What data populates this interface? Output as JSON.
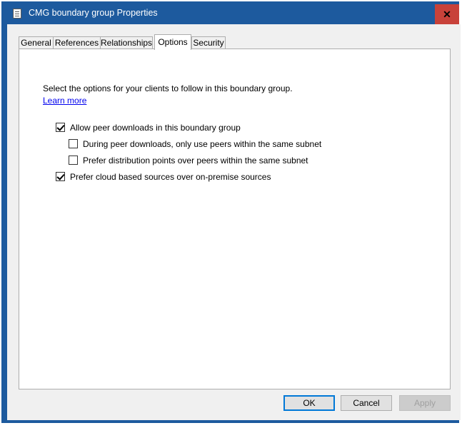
{
  "window": {
    "title": "CMG boundary group Properties",
    "close_glyph": "✕"
  },
  "tabs": [
    {
      "label": "General"
    },
    {
      "label": "References"
    },
    {
      "label": "Relationships"
    },
    {
      "label": "Options",
      "active": true
    },
    {
      "label": "Security"
    }
  ],
  "options_panel": {
    "description": "Select the options for your clients to follow in this boundary group.",
    "learn_more": "Learn more",
    "checkboxes": [
      {
        "label": "Allow peer downloads in this boundary group",
        "checked": true
      },
      {
        "label": "During peer downloads, only use peers within the same subnet",
        "checked": false
      },
      {
        "label": "Prefer distribution points over peers within the same subnet",
        "checked": false
      },
      {
        "label": "Prefer cloud based sources over on-premise sources",
        "checked": true
      }
    ]
  },
  "buttons": {
    "ok": "OK",
    "cancel": "Cancel",
    "apply": "Apply"
  },
  "colors": {
    "titlebar": "#1d5a9e",
    "close": "#c8423a",
    "link": "#0000ee"
  }
}
